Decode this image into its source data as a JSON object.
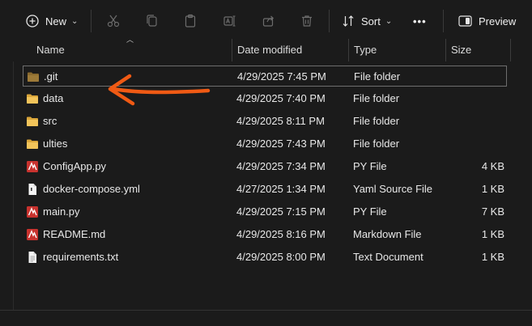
{
  "toolbar": {
    "new_label": "New",
    "sort_label": "Sort",
    "preview_label": "Preview",
    "more_label": "•••"
  },
  "columns": {
    "name": "Name",
    "date": "Date modified",
    "type": "Type",
    "size": "Size"
  },
  "files": [
    {
      "name": ".git",
      "date": "4/29/2025 7:45 PM",
      "type": "File folder",
      "size": "",
      "icon": "folder-dark-icon"
    },
    {
      "name": "data",
      "date": "4/29/2025 7:40 PM",
      "type": "File folder",
      "size": "",
      "icon": "folder-icon"
    },
    {
      "name": "src",
      "date": "4/29/2025 8:11 PM",
      "type": "File folder",
      "size": "",
      "icon": "folder-icon"
    },
    {
      "name": "ulties",
      "date": "4/29/2025 7:43 PM",
      "type": "File folder",
      "size": "",
      "icon": "folder-icon"
    },
    {
      "name": "ConfigApp.py",
      "date": "4/29/2025 7:34 PM",
      "type": "PY File",
      "size": "4 KB",
      "icon": "python-file-icon"
    },
    {
      "name": "docker-compose.yml",
      "date": "4/27/2025 1:34 PM",
      "type": "Yaml Source File",
      "size": "1 KB",
      "icon": "document-icon"
    },
    {
      "name": "main.py",
      "date": "4/29/2025 7:15 PM",
      "type": "PY File",
      "size": "7 KB",
      "icon": "python-file-icon"
    },
    {
      "name": "README.md",
      "date": "4/29/2025 8:16 PM",
      "type": "Markdown File",
      "size": "1 KB",
      "icon": "python-file-icon"
    },
    {
      "name": "requirements.txt",
      "date": "4/29/2025 8:00 PM",
      "type": "Text Document",
      "size": "1 KB",
      "icon": "text-file-icon"
    }
  ],
  "colors": {
    "folder": "#e8b84a",
    "folder_dark": "#8a6a2e",
    "arrow": "#f05a14",
    "brand_red": "#c8322e"
  }
}
